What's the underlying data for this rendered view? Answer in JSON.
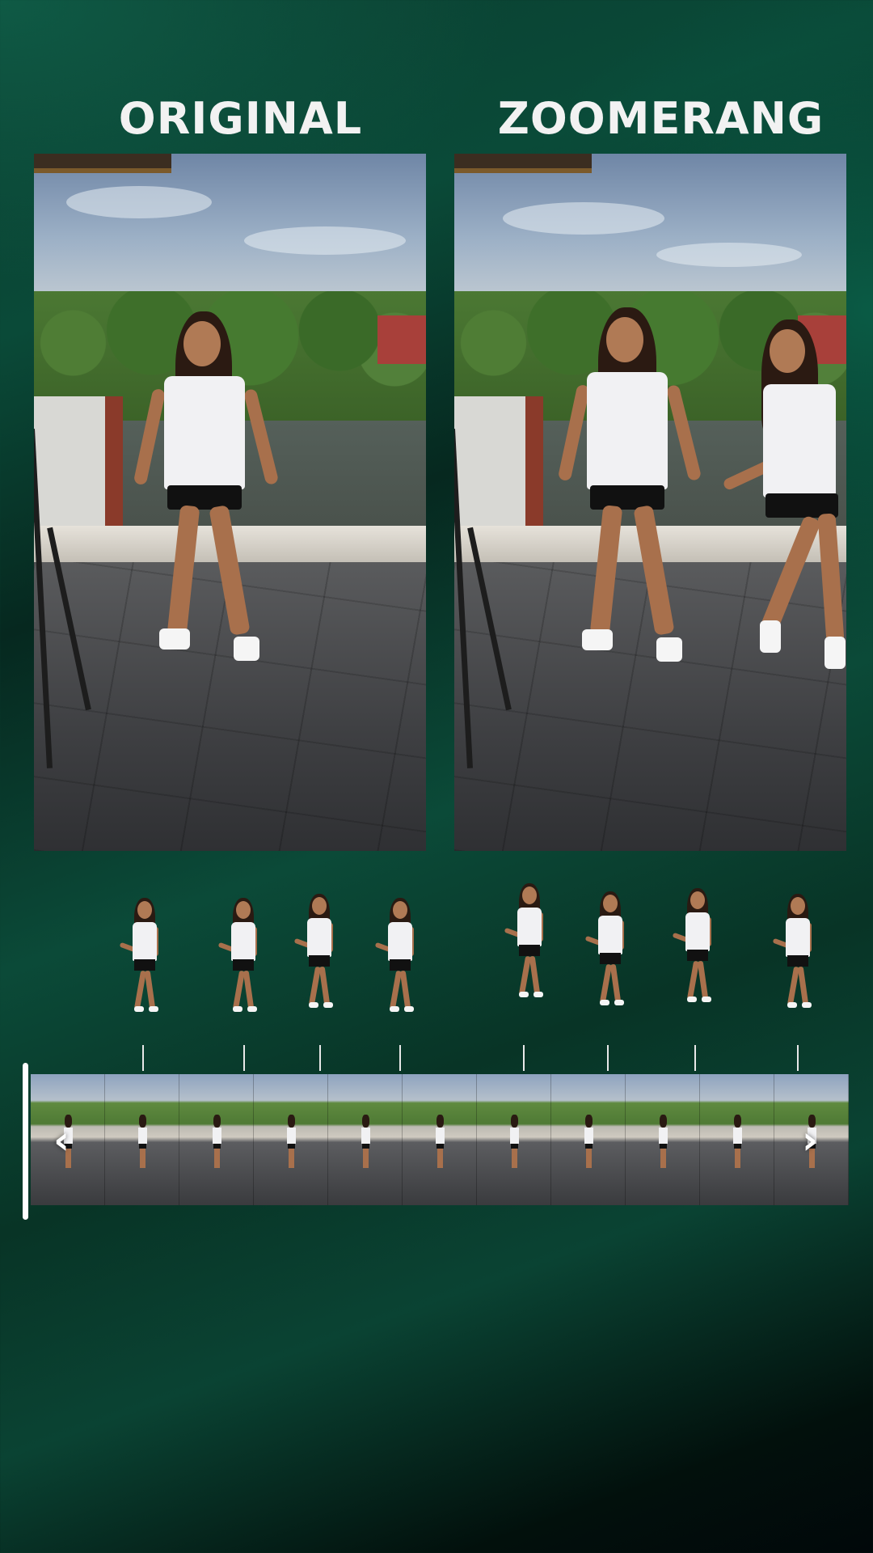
{
  "labels": {
    "left_title": "ORIGINAL",
    "right_title": "ZOOMERANG"
  },
  "timeline": {
    "prev_icon": "chevron-left-icon",
    "next_icon": "chevron-right-icon",
    "prev_glyph": "‹",
    "next_glyph": "›",
    "frame_count": 11
  },
  "figures": {
    "count": 8
  },
  "colors": {
    "title_text": "#f2f2f2",
    "background_primary": "#0a4a38",
    "playhead": "#ffffff"
  }
}
